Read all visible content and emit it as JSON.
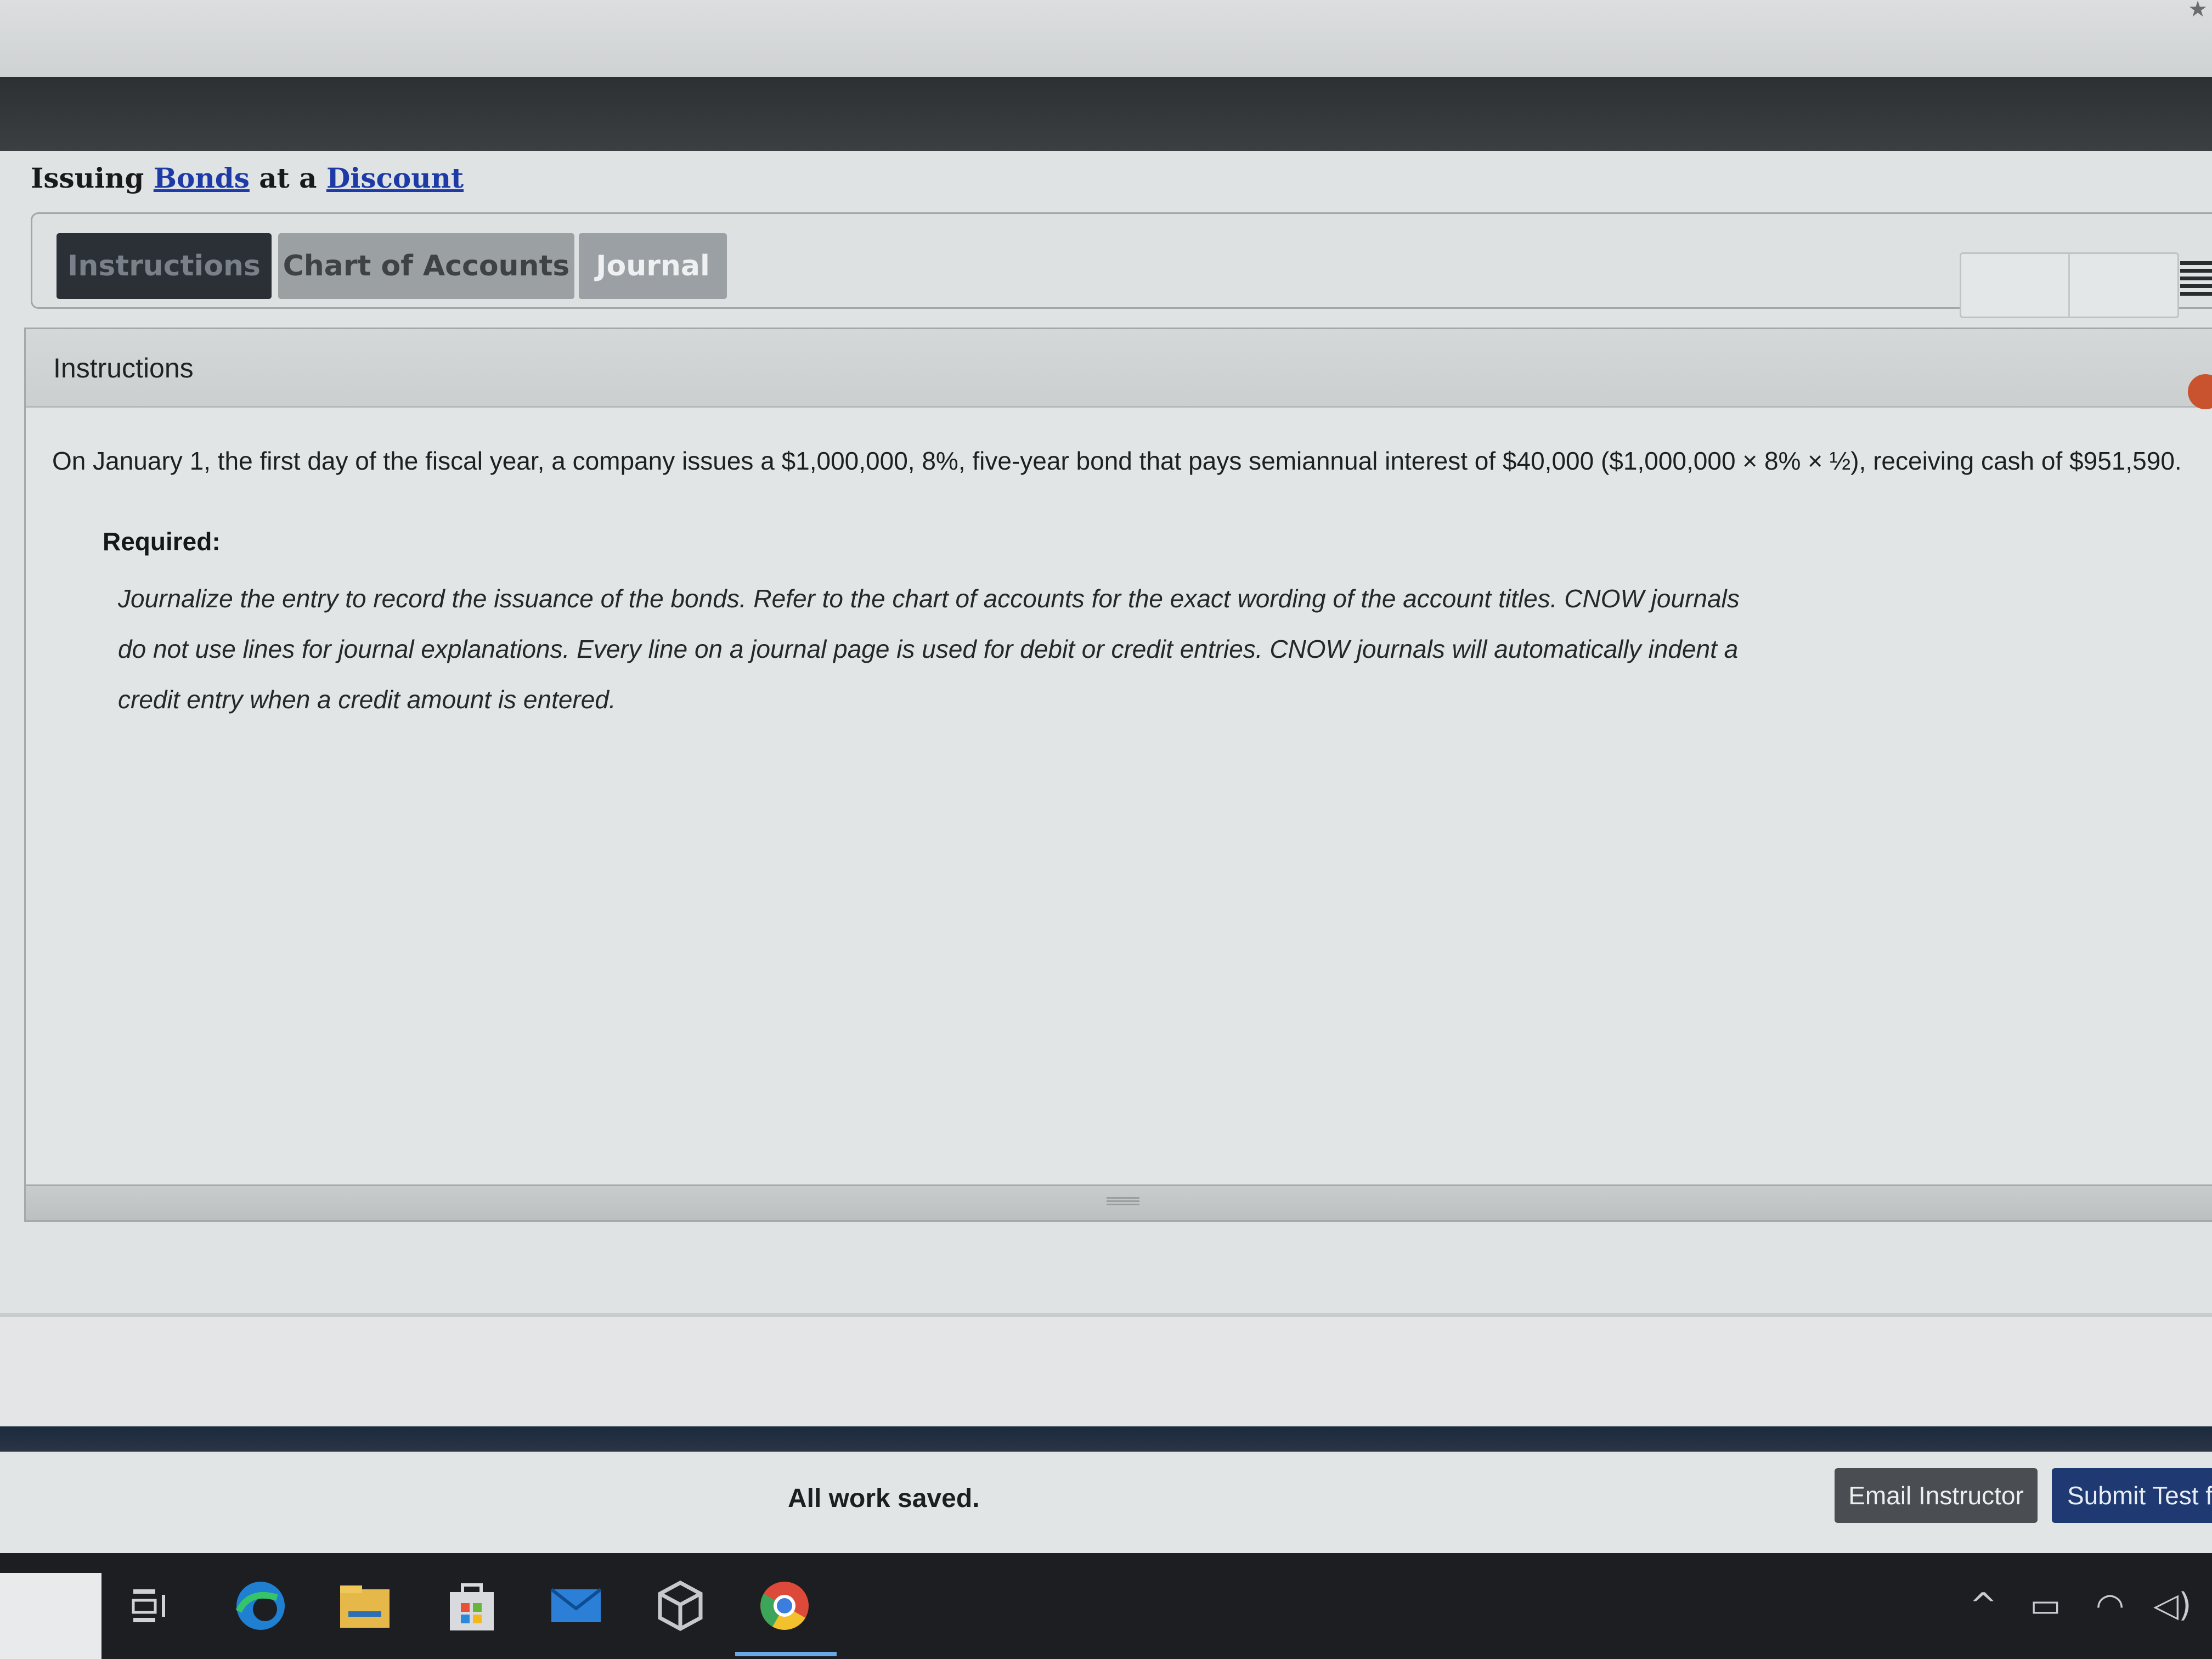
{
  "title": {
    "prefix": "Issuing ",
    "link1": "Bonds",
    "middle": " at a ",
    "link2": "Discount"
  },
  "tabs": [
    {
      "label": "Instructions",
      "active": true
    },
    {
      "label": "Chart of Accounts",
      "active": false
    },
    {
      "label": "Journal",
      "active": false
    }
  ],
  "panel": {
    "title": "Instructions",
    "body": "On January 1, the first day of the fiscal year, a company issues a $1,000,000, 8%, five-year bond that pays semiannual interest of $40,000 ($1,000,000 × 8% × ½), receiving cash of $951,590.",
    "required_label": "Required:",
    "directions": "Journalize the entry to record the issuance of the bonds. Refer to the chart of accounts for the exact wording of the account titles. CNOW journals do not use lines for journal explanations. Every line on a journal page is used for debit or credit entries. CNOW journals will automatically indent a credit entry when a credit amount is entered."
  },
  "footer": {
    "status": "All work saved.",
    "email_button": "Email Instructor",
    "submit_button": "Submit Test f"
  },
  "taskbar": {
    "apps": [
      "task-view-icon",
      "edge-icon",
      "file-explorer-icon",
      "store-icon",
      "mail-icon",
      "cube-app-icon",
      "chrome-icon"
    ],
    "tray": [
      "chevron-up-icon",
      "battery-icon",
      "wifi-icon",
      "volume-icon"
    ]
  },
  "colors": {
    "dark_header": "#2d3033",
    "active_tab": "#2b3037",
    "inactive_tab": "#9ba0a3",
    "link": "#1d3aa7",
    "submit_button": "#1f3a72",
    "email_button": "#4a4e52",
    "taskbar": "#1c1e22"
  }
}
